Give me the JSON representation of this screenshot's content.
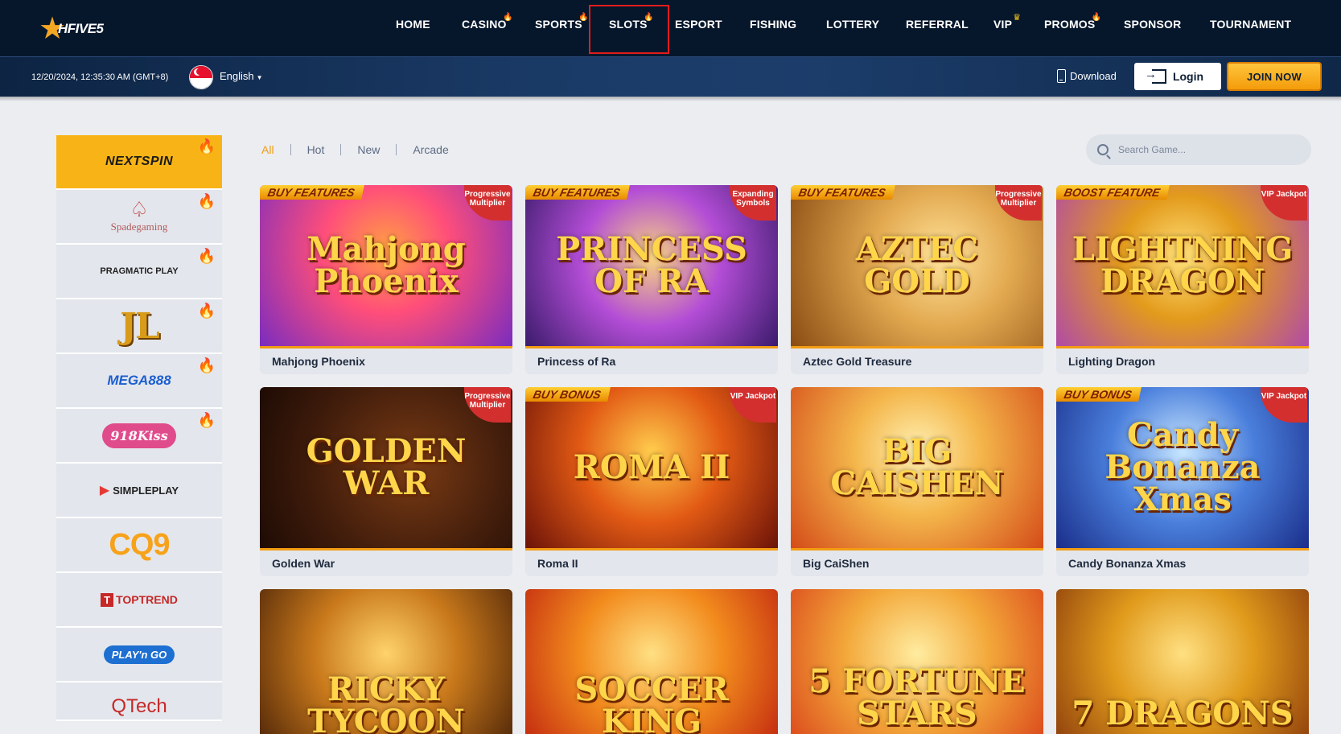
{
  "logo": {
    "text": "HFIVE5"
  },
  "nav": [
    {
      "label": "HOME",
      "flag": ""
    },
    {
      "label": "CASINO",
      "flag": "fire"
    },
    {
      "label": "SPORTS",
      "flag": "fire"
    },
    {
      "label": "SLOTS",
      "flag": "fire"
    },
    {
      "label": "ESPORT",
      "flag": ""
    },
    {
      "label": "FISHING",
      "flag": ""
    },
    {
      "label": "LOTTERY",
      "flag": ""
    },
    {
      "label": "REFERRAL",
      "flag": ""
    },
    {
      "label": "VIP",
      "flag": "crown"
    },
    {
      "label": "PROMOS",
      "flag": "fire"
    },
    {
      "label": "SPONSOR",
      "flag": ""
    },
    {
      "label": "TOURNAMENT",
      "flag": ""
    }
  ],
  "active_nav": "SLOTS",
  "subbar": {
    "datetime": "12/20/2024, 12:35:30 AM (GMT+8)",
    "language": "English",
    "download_label": "Download",
    "login_label": "Login",
    "join_label": "JOIN NOW"
  },
  "providers": [
    {
      "name": "NEXTSPIN",
      "hot": true,
      "active": true
    },
    {
      "name": "Spadegaming",
      "hot": true,
      "active": false
    },
    {
      "name": "PRAGMATIC PLAY",
      "hot": true,
      "active": false
    },
    {
      "name": "JL",
      "hot": true,
      "active": false
    },
    {
      "name": "MEGA888",
      "hot": true,
      "active": false
    },
    {
      "name": "918Kiss",
      "hot": true,
      "active": false
    },
    {
      "name": "SIMPLEPLAY",
      "hot": false,
      "active": false
    },
    {
      "name": "CQ9",
      "hot": false,
      "active": false
    },
    {
      "name": "TOPTREND",
      "hot": false,
      "active": false
    },
    {
      "name": "PLAY'n GO",
      "hot": false,
      "active": false
    },
    {
      "name": "QTech",
      "hot": false,
      "active": false
    }
  ],
  "filters": {
    "all": "All",
    "hot": "Hot",
    "new": "New",
    "arcade": "Arcade"
  },
  "search": {
    "placeholder": "Search Game..."
  },
  "games": [
    {
      "name": "Mahjong Phoenix",
      "art": "Mahjong Phoenix",
      "ribbon": "BUY FEATURES",
      "badge": "Progressive Multiplier"
    },
    {
      "name": "Princess of Ra",
      "art": "PRINCESS OF RA",
      "ribbon": "BUY FEATURES",
      "badge": "Expanding Symbols"
    },
    {
      "name": "Aztec Gold Treasure",
      "art": "AZTEC GOLD",
      "ribbon": "BUY FEATURES",
      "badge": "Progressive Multiplier"
    },
    {
      "name": "Lighting Dragon",
      "art": "LIGHTNING DRAGON",
      "ribbon": "BOOST FEATURE",
      "badge": "VIP Jackpot"
    },
    {
      "name": "Golden War",
      "art": "GOLDEN WAR",
      "ribbon": "",
      "badge": "Progressive Multiplier"
    },
    {
      "name": "Roma II",
      "art": "ROMA II",
      "ribbon": "BUY BONUS",
      "badge": "VIP Jackpot"
    },
    {
      "name": "Big CaiShen",
      "art": "BIG CAISHEN",
      "ribbon": "",
      "badge": ""
    },
    {
      "name": "Candy Bonanza Xmas",
      "art": "Candy Bonanza Xmas",
      "ribbon": "BUY BONUS",
      "badge": "VIP Jackpot"
    },
    {
      "name": "",
      "art": "RICKY TYCOON",
      "ribbon": "",
      "badge": ""
    },
    {
      "name": "",
      "art": "SOCCER KING",
      "ribbon": "",
      "badge": ""
    },
    {
      "name": "",
      "art": "5 FORTUNE STARS",
      "ribbon": "",
      "badge": ""
    },
    {
      "name": "",
      "art": "7 DRAGONS",
      "ribbon": "",
      "badge": ""
    }
  ]
}
